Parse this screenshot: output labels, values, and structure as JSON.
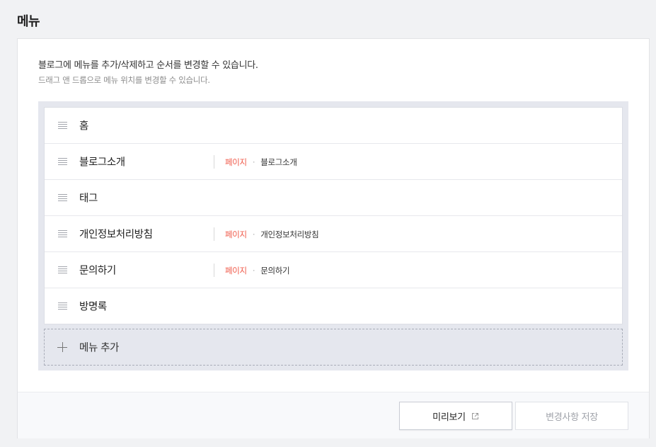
{
  "page": {
    "title": "메뉴"
  },
  "description": {
    "main": "블로그에 메뉴를 추가/삭제하고 순서를 변경할 수 있습니다.",
    "sub": "드래그 앤 드롭으로 메뉴 위치를 변경할 수 있습니다."
  },
  "menu": {
    "items": [
      {
        "name": "홈",
        "type": "",
        "target": ""
      },
      {
        "name": "블로그소개",
        "type": "페이지",
        "target": "블로그소개"
      },
      {
        "name": "태그",
        "type": "",
        "target": ""
      },
      {
        "name": "개인정보처리방침",
        "type": "페이지",
        "target": "개인정보처리방침"
      },
      {
        "name": "문의하기",
        "type": "페이지",
        "target": "문의하기"
      },
      {
        "name": "방명록",
        "type": "",
        "target": ""
      }
    ],
    "separator": "·",
    "add_label": "메뉴 추가"
  },
  "footer": {
    "preview_label": "미리보기",
    "save_label": "변경사항 저장"
  },
  "colors": {
    "type_accent": "#f05a4a",
    "panel_bg": "#e5e7ee",
    "page_bg": "#f1f2f4"
  },
  "icons": {
    "drag": "drag-handle-icon",
    "add": "plus-icon",
    "preview": "external-link-icon"
  }
}
